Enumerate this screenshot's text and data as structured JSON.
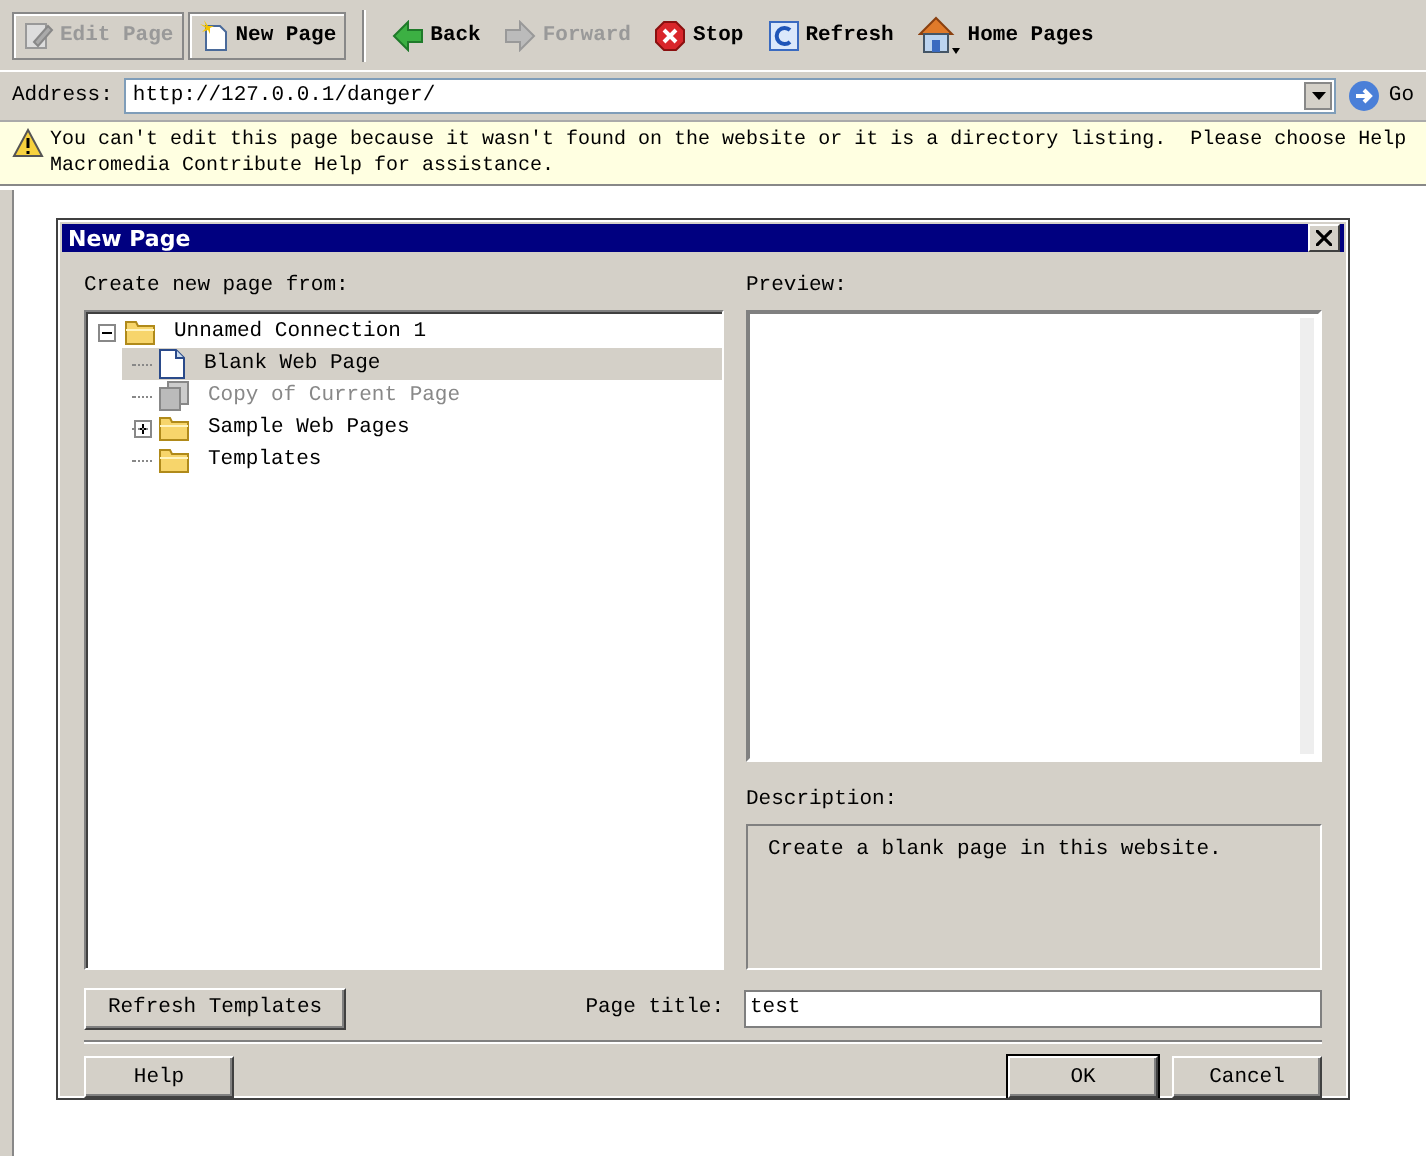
{
  "toolbar": {
    "items": [
      {
        "kind": "edit",
        "label": "Edit Page",
        "disabled": true
      },
      {
        "kind": "new",
        "label": "New Page",
        "disabled": false
      },
      {
        "kind": "back",
        "label": "Back",
        "disabled": false
      },
      {
        "kind": "forward",
        "label": "Forward",
        "disabled": true
      },
      {
        "kind": "stop",
        "label": "Stop",
        "disabled": false
      },
      {
        "kind": "refresh",
        "label": "Refresh",
        "disabled": false
      },
      {
        "kind": "home",
        "label": "Home Pages",
        "disabled": false
      }
    ]
  },
  "address_bar": {
    "label": "Address:",
    "value": "http://127.0.0.1/danger/",
    "go": "Go"
  },
  "warning": {
    "text": "You can't edit this page because it wasn't found on the website or it is a directory listing.  Please choose Help\nMacromedia Contribute Help for assistance."
  },
  "dialog": {
    "title": "New Page",
    "source_label": "Create new page from:",
    "tree": [
      {
        "label": "Unnamed Connection 1",
        "kind": "folder",
        "expanded": true,
        "selected": false,
        "disabled": false,
        "children": [
          {
            "label": "Blank Web Page",
            "kind": "page",
            "selected": true,
            "disabled": false
          },
          {
            "label": "Copy of Current Page",
            "kind": "copy",
            "selected": false,
            "disabled": true
          },
          {
            "label": "Sample Web Pages",
            "kind": "folder",
            "expanded": false,
            "selected": false,
            "disabled": false
          },
          {
            "label": "Templates",
            "kind": "folder",
            "selected": false,
            "disabled": false
          }
        ]
      }
    ],
    "preview_label": "Preview:",
    "description_label": "Description:",
    "description": "Create a blank page in this website.",
    "refresh_button": "Refresh Templates",
    "page_title_label": "Page title:",
    "page_title_value": "test",
    "help_button": "Help",
    "ok_button": "OK",
    "cancel_button": "Cancel"
  }
}
